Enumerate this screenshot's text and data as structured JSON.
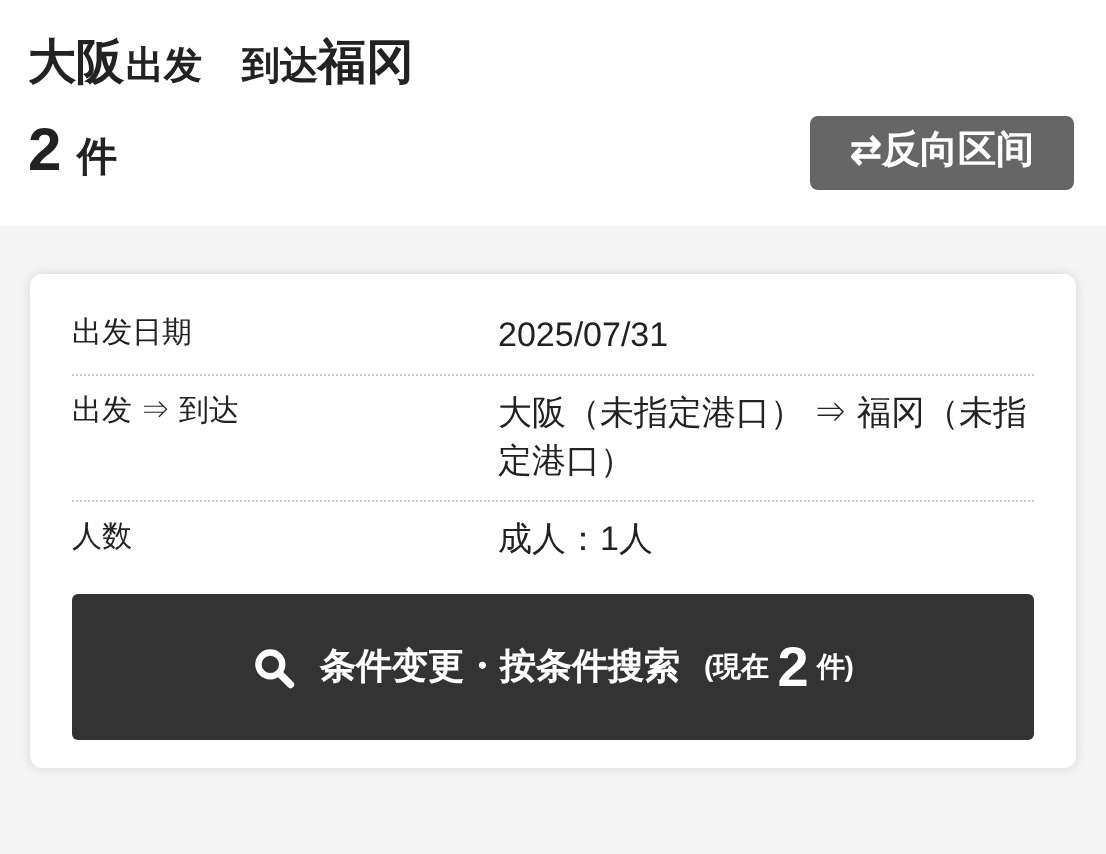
{
  "header": {
    "origin": "大阪",
    "origin_suffix": "出发",
    "destination_prefix": "到达",
    "destination": "福冈",
    "count": "2",
    "count_unit": "件",
    "reverse_button": "⇄反向区间"
  },
  "conditions": [
    {
      "label": "出发日期",
      "value": "2025/07/31"
    },
    {
      "label": "出发 ⇒ 到达",
      "value": "大阪（未指定港口） ⇒ 福冈（未指定港口）"
    },
    {
      "label": "人数",
      "value": "成人：1人"
    }
  ],
  "search_button": {
    "label": "条件变更・按条件搜索",
    "current_prefix": "(現在",
    "current_count": "2",
    "current_suffix": "件)"
  }
}
